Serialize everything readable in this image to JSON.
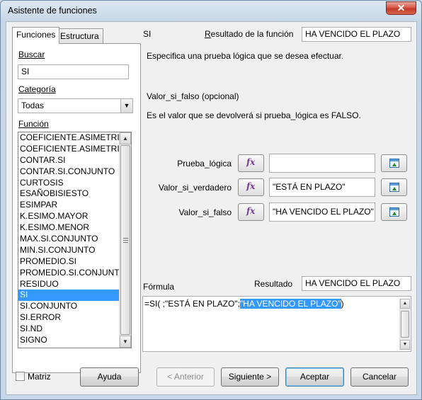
{
  "window": {
    "title": "Asistente de funciones",
    "close_glyph": "✕"
  },
  "tabs": [
    {
      "label": "Funciones",
      "active": true
    },
    {
      "label": "Estructura",
      "active": false
    }
  ],
  "search": {
    "label": "Buscar",
    "value": "SI"
  },
  "category": {
    "label": "Categoría",
    "value": "Todas"
  },
  "functions": {
    "label": "Función",
    "items": [
      "COEFICIENTE.ASIMETRIA",
      "COEFICIENTE.ASIMETRIA.P",
      "CONTAR.SI",
      "CONTAR.SI.CONJUNTO",
      "CURTOSIS",
      "ESAÑOBISIESTO",
      "ESIMPAR",
      "K.ESIMO.MAYOR",
      "K.ESIMO.MENOR",
      "MAX.SI.CONJUNTO",
      "MIN.SI.CONJUNTO",
      "PROMEDIO.SI",
      "PROMEDIO.SI.CONJUNTO",
      "RESIDUO",
      "SI",
      "SI.CONJUNTO",
      "SI.ERROR",
      "SI.ND",
      "SIGNO"
    ],
    "selected": "SI"
  },
  "function_info": {
    "name": "SI",
    "result_label": "Resultado de la función",
    "result_value": "HA VENCIDO EL PLAZO",
    "description": "Especifica una prueba lógica que se desea efectuar.",
    "param_name": "Valor_si_falso (opcional)",
    "param_description": "Es el valor que se devolverá si prueba_lógica es FALSO."
  },
  "arguments": [
    {
      "label": "Prueba_lógica",
      "value": ""
    },
    {
      "label": "Valor_si_verdadero",
      "value": "\"ESTÁ EN PLAZO\""
    },
    {
      "label": "Valor_si_falso",
      "value": "\"HA VENCIDO EL PLAZO\""
    }
  ],
  "fx_glyph": "fx",
  "formula": {
    "label": "Fórmula",
    "result_label": "Resultado",
    "result_value": "HA VENCIDO EL PLAZO",
    "text_before": "=SI( ;\"ESTÁ EN PLAZO\";",
    "text_selected": "\"HA VENCIDO EL PLAZO\"",
    "text_after": ")"
  },
  "footer": {
    "matrix_label": "Matriz",
    "help": "Ayuda",
    "back": "< Anterior",
    "next": "Siguiente >",
    "accept": "Aceptar",
    "cancel": "Cancelar"
  },
  "icons": {
    "fx": "function-wizard-icon",
    "shrink": "shrink-dialog-icon",
    "dropdown": "chevron-down-icon",
    "scroll_up": "scroll-up-arrow-icon",
    "scroll_down": "scroll-down-arrow-icon"
  }
}
